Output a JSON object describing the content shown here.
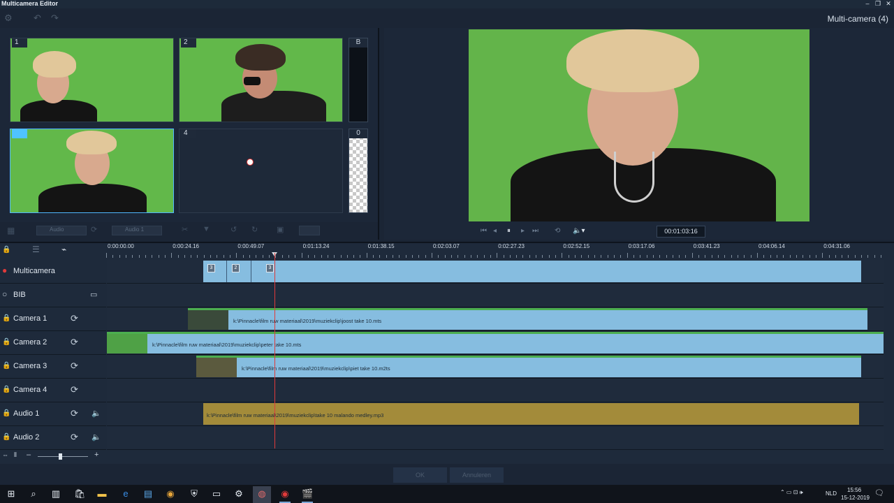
{
  "window": {
    "title": "Multicamera Editor",
    "view_title": "Multi-camera (4)"
  },
  "cameras": [
    {
      "num": "1",
      "selected": false
    },
    {
      "num": "2",
      "selected": false
    },
    {
      "num": "",
      "selected": true
    },
    {
      "num": "4",
      "selected": false
    }
  ],
  "side_slots": [
    {
      "label": "B"
    },
    {
      "label": "0"
    }
  ],
  "left_controls": {
    "audio_label": "Audio",
    "audio1_label": "Audio 1"
  },
  "preview": {
    "timecode": "00:01:03:16"
  },
  "ruler_ticks": [
    "0:00:00.00",
    "0:00:24.16",
    "0:00:49.07",
    "0:01:13.24",
    "0:01:38.15",
    "0:02:03.07",
    "0:02:27.23",
    "0:02:52.15",
    "0:03:17.06",
    "0:03:41.23",
    "0:04:06.14",
    "0:04:31.06"
  ],
  "tracks": [
    {
      "name": "Multicamera"
    },
    {
      "name": "BIB"
    },
    {
      "name": "Camera 1"
    },
    {
      "name": "Camera 2"
    },
    {
      "name": "Camera 3"
    },
    {
      "name": "Camera 4"
    },
    {
      "name": "Audio 1"
    },
    {
      "name": "Audio 2"
    }
  ],
  "multicam_markers": [
    "3",
    "2",
    "3"
  ],
  "clips": {
    "cam1": "k:\\Pinnacle\\film ruw materiaal\\2019\\muziekclip\\joost take 10.mts",
    "cam2": "k:\\Pinnacle\\film ruw materiaal\\2019\\muziekclip\\peter take 10.mts",
    "cam3": "k:\\Pinnacle\\film ruw materiaal\\2019\\muziekclip\\piet take 10.m2ts",
    "audio1": "k:\\Pinnacle\\film ruw materiaal\\2019\\muziekclip\\take 10 malando medley.mp3"
  },
  "buttons": {
    "ok": "OK",
    "cancel": "Annuleren"
  },
  "taskbar": {
    "lang": "NLD",
    "time": "15:56",
    "date": "15-12-2019"
  },
  "colors": {
    "accent": "#4fc3ff",
    "clip": "#86bde0",
    "audio_clip": "#a38b3a",
    "playhead": "#e03a3a",
    "green_screen": "#62b84a"
  }
}
